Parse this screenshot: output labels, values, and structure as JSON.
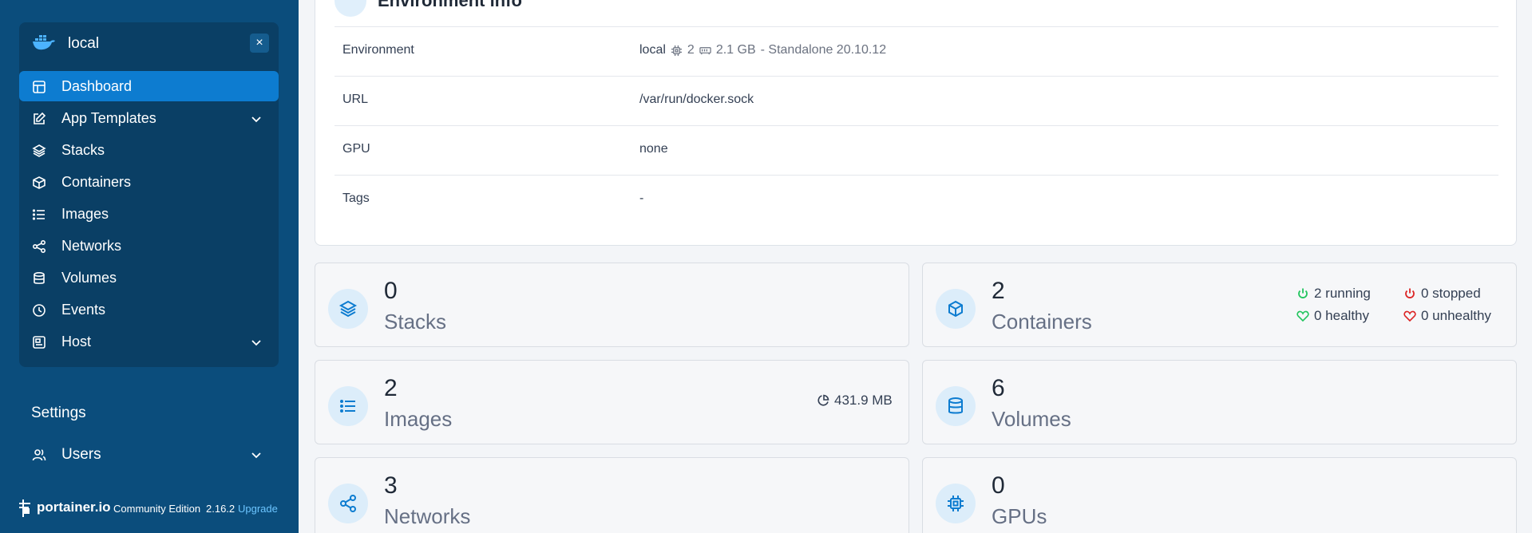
{
  "sidebar": {
    "environment": {
      "name": "local",
      "close": "×"
    },
    "nav": [
      {
        "label": "Dashboard",
        "icon": "dashboard-icon",
        "active": true
      },
      {
        "label": "App Templates",
        "icon": "edit-icon",
        "expandable": true
      },
      {
        "label": "Stacks",
        "icon": "layers-icon"
      },
      {
        "label": "Containers",
        "icon": "box-icon"
      },
      {
        "label": "Images",
        "icon": "list-icon"
      },
      {
        "label": "Networks",
        "icon": "share-icon"
      },
      {
        "label": "Volumes",
        "icon": "database-icon"
      },
      {
        "label": "Events",
        "icon": "clock-icon"
      },
      {
        "label": "Host",
        "icon": "host-icon",
        "expandable": true
      }
    ],
    "settings_label": "Settings",
    "users_label": "Users",
    "footer": {
      "brand": "portainer.io",
      "edition": "Community Edition",
      "version": "2.16.2",
      "upgrade": "Upgrade"
    }
  },
  "env_info": {
    "title": "Environment info",
    "rows": [
      {
        "key": "Environment",
        "name": "local",
        "cpu": "2",
        "memory": "2.1 GB",
        "mode": "- Standalone 20.10.12"
      },
      {
        "key": "URL",
        "value": "/var/run/docker.sock"
      },
      {
        "key": "GPU",
        "value": "none"
      },
      {
        "key": "Tags",
        "value": "-"
      }
    ]
  },
  "stats": {
    "stacks": {
      "count": "0",
      "label": "Stacks"
    },
    "containers": {
      "count": "2",
      "label": "Containers",
      "running": "2 running",
      "stopped": "0 stopped",
      "healthy": "0 healthy",
      "unhealthy": "0 unhealthy"
    },
    "images": {
      "count": "2",
      "label": "Images",
      "size": "431.9 MB"
    },
    "volumes": {
      "count": "6",
      "label": "Volumes"
    },
    "networks": {
      "count": "3",
      "label": "Networks"
    },
    "gpus": {
      "count": "0",
      "label": "GPUs"
    }
  },
  "colors": {
    "sidebar": "#0b4d7c",
    "active": "#0d7cd0",
    "accent": "#0d7cd0",
    "running": "#22c55e",
    "stopped": "#dc2626"
  }
}
